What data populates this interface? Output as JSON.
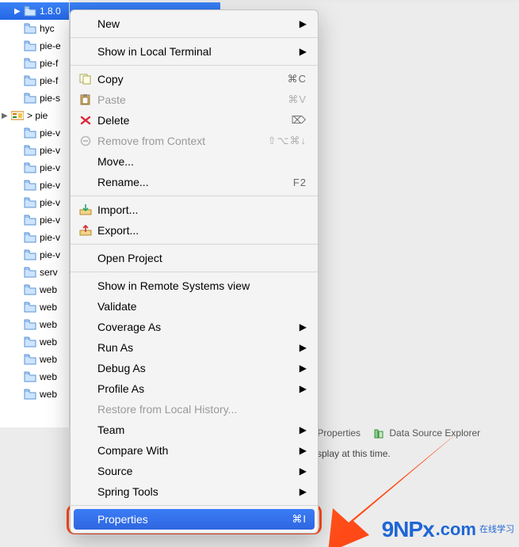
{
  "tree": {
    "selected_label": "1.8.0",
    "items": [
      {
        "label": "1.8.0",
        "selected": true,
        "arrow": "▶"
      },
      {
        "label": "hyc"
      },
      {
        "label": "pie-e"
      },
      {
        "label": "pie-f"
      },
      {
        "label": "pie-f"
      },
      {
        "label": "pie-s"
      },
      {
        "label": "> pie",
        "decorated": true,
        "arrow": "▶"
      },
      {
        "label": "pie-v"
      },
      {
        "label": "pie-v"
      },
      {
        "label": "pie-v"
      },
      {
        "label": "pie-v"
      },
      {
        "label": "pie-v"
      },
      {
        "label": "pie-v"
      },
      {
        "label": "pie-v"
      },
      {
        "label": "pie-v"
      },
      {
        "label": "serv"
      },
      {
        "label": "web"
      },
      {
        "label": "web"
      },
      {
        "label": "web"
      },
      {
        "label": "web"
      },
      {
        "label": "web"
      },
      {
        "label": "web"
      },
      {
        "label": "web"
      }
    ]
  },
  "menu": {
    "groups": [
      [
        {
          "label": "New",
          "submenu": true
        }
      ],
      [
        {
          "label": "Show in Local Terminal",
          "submenu": true
        }
      ],
      [
        {
          "label": "Copy",
          "icon": "copy-icon",
          "shortcut": "⌘C"
        },
        {
          "label": "Paste",
          "icon": "paste-icon",
          "shortcut": "⌘V",
          "disabled": true
        },
        {
          "label": "Delete",
          "icon": "delete-icon",
          "shortcut": "⌦"
        },
        {
          "label": "Remove from Context",
          "icon": "remove-context-icon",
          "shortcut": "⇧⌥⌘↓",
          "disabled": true
        },
        {
          "label": "Move..."
        },
        {
          "label": "Rename...",
          "shortcut": "F2"
        }
      ],
      [
        {
          "label": "Import...",
          "icon": "import-icon"
        },
        {
          "label": "Export...",
          "icon": "export-icon"
        }
      ],
      [
        {
          "label": "Open Project"
        }
      ],
      [
        {
          "label": "Show in Remote Systems view"
        },
        {
          "label": "Validate"
        },
        {
          "label": "Coverage As",
          "submenu": true
        },
        {
          "label": "Run As",
          "submenu": true
        },
        {
          "label": "Debug As",
          "submenu": true
        },
        {
          "label": "Profile As",
          "submenu": true
        },
        {
          "label": "Restore from Local History...",
          "disabled": true
        },
        {
          "label": "Team",
          "submenu": true
        },
        {
          "label": "Compare With",
          "submenu": true
        },
        {
          "label": "Source",
          "submenu": true
        },
        {
          "label": "Spring Tools",
          "submenu": true
        }
      ],
      [
        {
          "label": "Properties",
          "shortcut": "⌘I",
          "highlight": true
        }
      ]
    ]
  },
  "tabs": {
    "properties": "Properties",
    "data_source_explorer": "Data Source Explorer"
  },
  "status_text": "splay at this time.",
  "watermark": {
    "brand": "9NPx",
    "dotcom": ".com",
    "cn": "在线学习"
  },
  "colors": {
    "highlight": "#ff4a1c",
    "selection": "#2f66e0"
  }
}
